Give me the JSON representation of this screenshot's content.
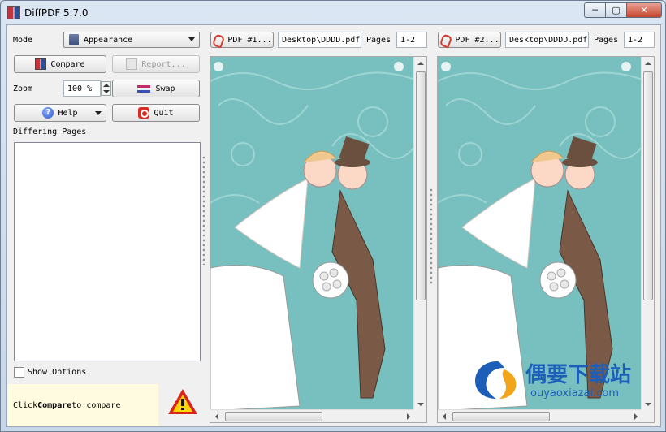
{
  "window": {
    "title": "DiffPDF 5.7.0",
    "controls": {
      "minimize": "─",
      "maximize": "▢",
      "close": "✕"
    }
  },
  "sidebar": {
    "mode_label": "Mode",
    "mode_value": "Appearance",
    "compare_label": "Compare",
    "report_label": "Report...",
    "zoom_label": "Zoom",
    "zoom_value": "100 %",
    "swap_label": "Swap",
    "help_label": "Help",
    "quit_label": "Quit",
    "differing_pages_label": "Differing Pages",
    "show_options_label": "Show Options",
    "show_options_checked": false,
    "status_prefix": "Click ",
    "status_bold": "Compare",
    "status_suffix": " to compare"
  },
  "pdf1": {
    "button_label": "PDF #1...",
    "file": "Desktop\\DDDD.pdf",
    "pages_label": "Pages",
    "pages_value": "1-2"
  },
  "pdf2": {
    "button_label": "PDF #2...",
    "file": "Desktop\\DDDD.pdf",
    "pages_label": "Pages",
    "pages_value": "1-2"
  },
  "watermark": {
    "title": "偶要下载站",
    "url": "ouyaoxiazai.com"
  },
  "icons": [
    "app-icon",
    "compare-icon",
    "report-icon",
    "swap-icon",
    "help-icon",
    "quit-icon",
    "pdf-icon",
    "warning-icon"
  ],
  "colors": {
    "page_background": "#78c0bf",
    "accent_blue": "#1d5fb8",
    "warning_red": "#d8261c",
    "status_background": "#fffbe0"
  }
}
